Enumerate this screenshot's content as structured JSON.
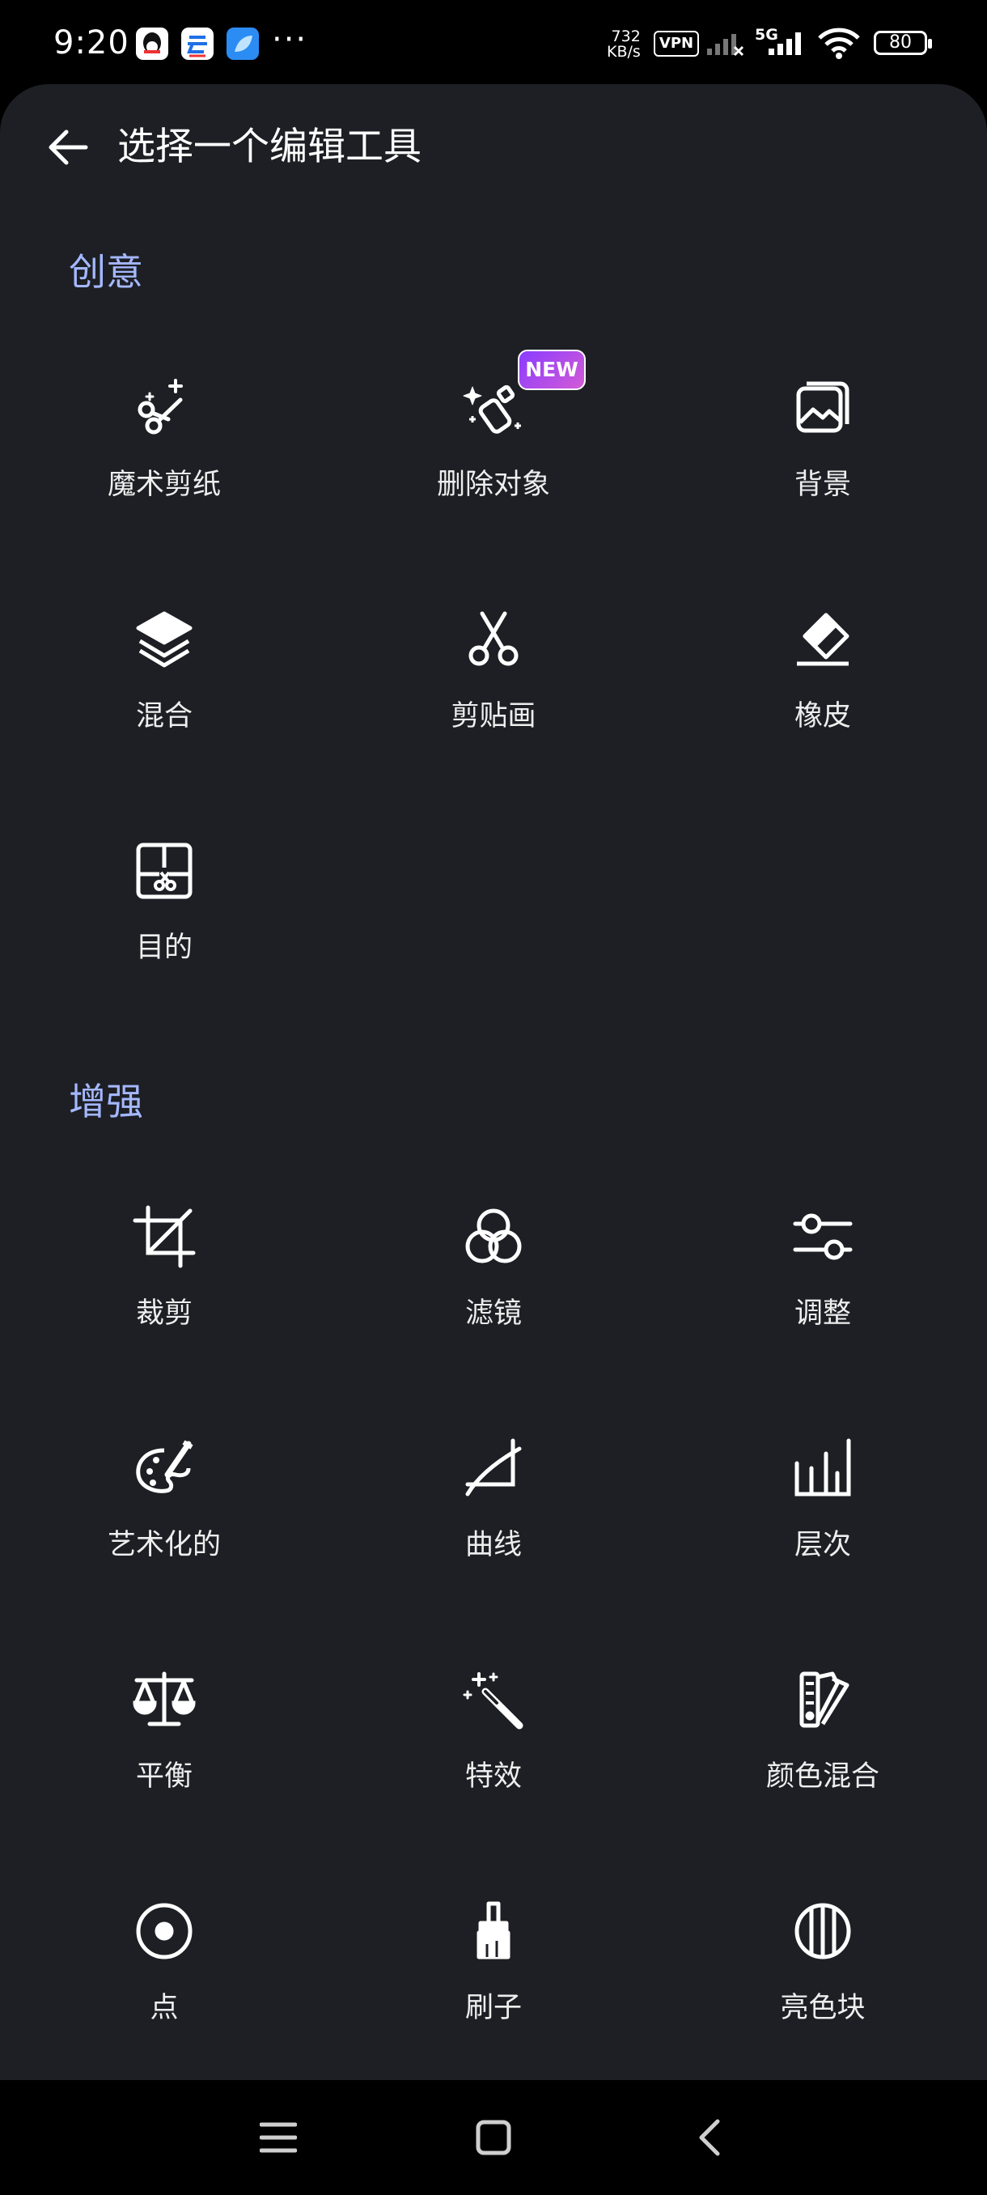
{
  "status_bar": {
    "time": "9:20",
    "net_speed_value": "732",
    "net_speed_unit": "KB/s",
    "vpn": "VPN",
    "network": "5G",
    "battery": "80",
    "more": "···"
  },
  "header": {
    "title": "选择一个编辑工具"
  },
  "sections": [
    {
      "title": "创意",
      "tools": [
        {
          "label": "魔术剪纸",
          "icon": "magic-scissors-icon"
        },
        {
          "label": "删除对象",
          "icon": "remove-object-icon",
          "badge": "NEW"
        },
        {
          "label": "背景",
          "icon": "background-image-icon"
        },
        {
          "label": "混合",
          "icon": "layers-icon"
        },
        {
          "label": "剪贴画",
          "icon": "scissors-icon"
        },
        {
          "label": "橡皮",
          "icon": "eraser-icon"
        },
        {
          "label": "目的",
          "icon": "cutout-frame-icon"
        }
      ]
    },
    {
      "title": "增强",
      "tools": [
        {
          "label": "裁剪",
          "icon": "crop-icon"
        },
        {
          "label": "滤镜",
          "icon": "filter-circles-icon"
        },
        {
          "label": "调整",
          "icon": "adjust-sliders-icon"
        },
        {
          "label": "艺术化的",
          "icon": "palette-icon"
        },
        {
          "label": "曲线",
          "icon": "curve-icon"
        },
        {
          "label": "层次",
          "icon": "levels-bars-icon"
        },
        {
          "label": "平衡",
          "icon": "balance-scale-icon"
        },
        {
          "label": "特效",
          "icon": "magic-wand-icon"
        },
        {
          "label": "颜色混合",
          "icon": "color-swatch-icon"
        },
        {
          "label": "点",
          "icon": "dot-circle-icon"
        },
        {
          "label": "刷子",
          "icon": "brush-icon"
        },
        {
          "label": "亮色块",
          "icon": "highlight-stripes-icon"
        }
      ]
    }
  ],
  "colors": {
    "background": "#1d1f24",
    "section_title": "#a5b8ff",
    "badge_gradient_start": "#8a3cff",
    "badge_gradient_end": "#d35bd6"
  },
  "nav_bar": {
    "icons": [
      "menu-icon",
      "home-square-icon",
      "back-chevron-icon"
    ]
  }
}
